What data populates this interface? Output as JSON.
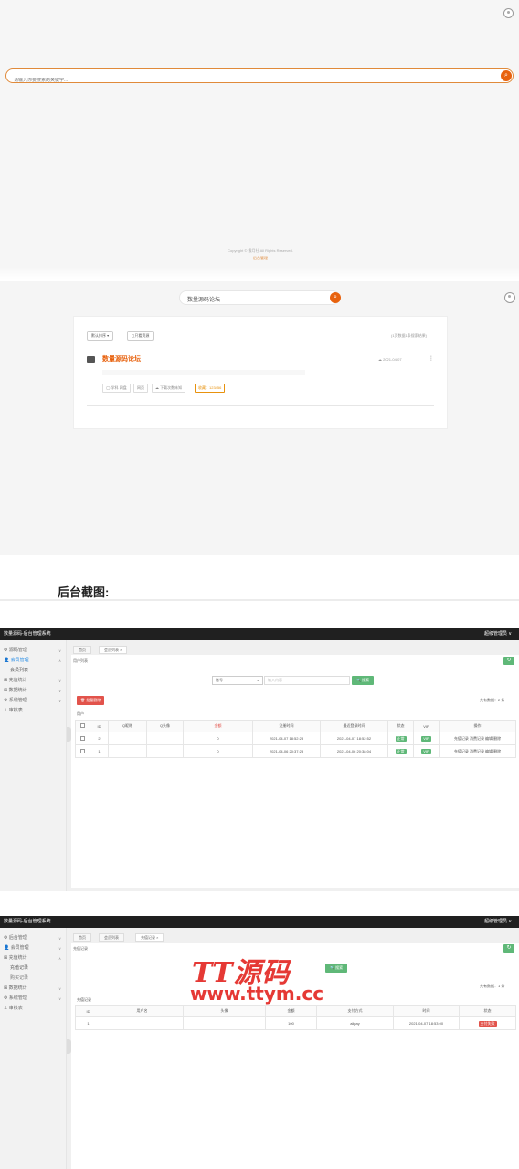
{
  "frontend": {
    "search_placeholder": "请输入你要搜索的关键字...",
    "copyright": "Copyright © 霸月社 All Rights Reserved.",
    "copyright_sub": "后台管理"
  },
  "result": {
    "search_value": "数量源码论坛",
    "btn_sort": "默认排序 ▾",
    "btn_filter": "◻只看资源",
    "stat": "(1页数据1条搜索结果)",
    "item_title": "数量源码论坛",
    "item_date": "☁ 2021-04-07",
    "more": "⋮",
    "tag_a": "◯ 学科 网盘",
    "tag_b": "网页",
    "tag_c": "☁ 下载次数未知",
    "tag_d": "收藏：123456"
  },
  "heading": "后台截图:",
  "admin1": {
    "app_title": "数量源码-后台管理系统",
    "user_menu": "超级管理员 ∨",
    "nav": [
      {
        "label": "⚙ 源码管理",
        "chevron": "∨"
      },
      {
        "label": "👤 会员管理",
        "chevron": "∧"
      },
      {
        "label": "会员列表",
        "chevron": ""
      },
      {
        "label": "⊞ 充值统计",
        "chevron": "∨"
      },
      {
        "label": "⊞ 数据统计",
        "chevron": "∨"
      },
      {
        "label": "⚙ 系统管理",
        "chevron": "∨"
      },
      {
        "label": "⊥ 审核表",
        "chevron": ""
      }
    ],
    "tabs": [
      "首页",
      "会员列表 ×"
    ],
    "breadcrumb": "用户列表",
    "select_value": "账号",
    "search_placeholder": "输入内容",
    "search_btn": "🔍 搜索",
    "delete_btn": "🗑 批量删除",
    "total": "共有数据：2 条",
    "section": "用户",
    "columns": [
      "",
      "ID",
      "Q昵称",
      "Q头像",
      "金额",
      "注册时间",
      "最近登录时间",
      "状态",
      "VIP",
      "操作"
    ],
    "rows": [
      {
        "id": "2",
        "nick": "",
        "avatar": "",
        "money": "0",
        "reg": "2021-04-07 18:52:23",
        "login": "2021-04-07 18:52:52",
        "status": "正常",
        "vip": "VIP",
        "ops": "充值记录 消费记录 编辑 删除"
      },
      {
        "id": "1",
        "nick": "",
        "avatar": "",
        "money": "0",
        "reg": "2021-04-06 20:37:23",
        "login": "2021-04-06 20:38:04",
        "status": "正常",
        "vip": "VIP",
        "ops": "充值记录 消费记录 编辑 删除"
      }
    ]
  },
  "admin2": {
    "app_title": "数量源码-后台管理系统",
    "user_menu": "超级管理员 ∨",
    "nav": [
      {
        "label": "⚙ 后台管理",
        "chevron": "∨"
      },
      {
        "label": "👤 会员管理",
        "chevron": "∨"
      },
      {
        "label": "⊞ 充值统计",
        "chevron": "∧"
      },
      {
        "label": "充值记录",
        "chevron": ""
      },
      {
        "label": "购买记录",
        "chevron": ""
      },
      {
        "label": "⊞ 数据统计",
        "chevron": "∨"
      },
      {
        "label": "⚙ 系统管理",
        "chevron": "∨"
      },
      {
        "label": "⊥ 审核表",
        "chevron": ""
      }
    ],
    "tabs": [
      "首页",
      "会员列表",
      "充值记录 ×"
    ],
    "breadcrumb": "充值记录",
    "search_btn": "🔍 搜索",
    "total": "共有数据：1 条",
    "section": "充值记录",
    "columns": [
      "ID",
      "用户名",
      "头像",
      "金额",
      "支付方式",
      "时间",
      "状态"
    ],
    "rows": [
      {
        "id": "1",
        "user": "",
        "avatar": "",
        "money": "100",
        "method": "alipay",
        "time": "2021-04-07 18:53:00",
        "status": "支付失败"
      }
    ]
  },
  "watermark": {
    "line1": "TT源码",
    "line2": "www.ttym.cc"
  }
}
